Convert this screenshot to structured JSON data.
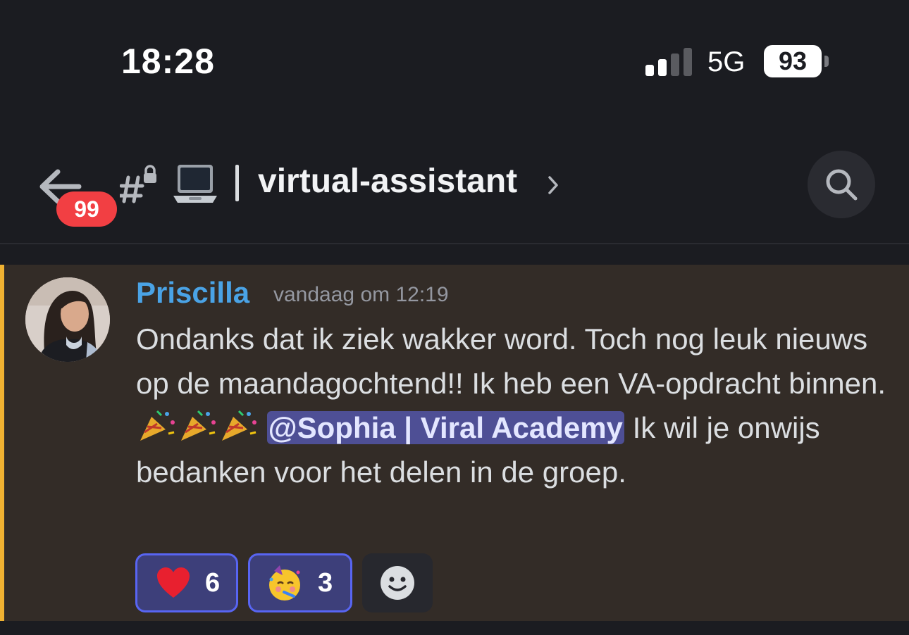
{
  "status_bar": {
    "time": "18:28",
    "network": "5G",
    "battery": "93",
    "signal_bars_active": 2,
    "signal_bars_total": 4
  },
  "header": {
    "unread_badge": "99",
    "channel_name": "virtual-assistant",
    "channel_emoji_icon": "laptop-icon",
    "channel_type_icon": "locked-hash-icon"
  },
  "message": {
    "author": "Priscilla",
    "timestamp": "vandaag om 12:19",
    "text_part1": "Ondanks dat ik ziek wakker word.  Toch nog leuk nieuws op de maandagochtend!! Ik heb een VA-opdracht binnen. ",
    "mention": "@Sophia | Viral Academy",
    "text_part2": " Ik wil je onwijs bedanken voor het delen in de groep.",
    "reactions": [
      {
        "emoji": "red-heart-icon",
        "count": "6"
      },
      {
        "emoji": "partying-face-icon",
        "count": "3"
      }
    ]
  },
  "colors": {
    "background": "#1b1c21",
    "author": "#4aa3e6",
    "mention_bg": "#4e4f95",
    "highlight_bar": "#f0b232",
    "badge": "#f23f43",
    "reaction_border": "#5865f2"
  }
}
